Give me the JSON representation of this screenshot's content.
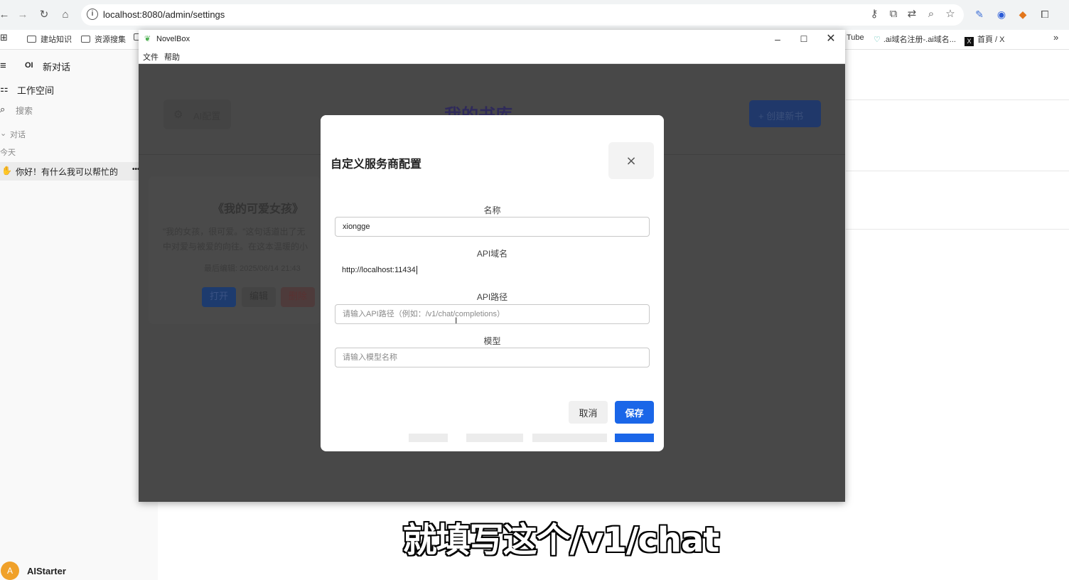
{
  "browser": {
    "url": "localhost:8080/admin/settings",
    "bookmarks": [
      "建站知识",
      "资源搜集",
      "Tube",
      ".ai域名注册-.ai域名...",
      "首頁 / X"
    ]
  },
  "sidebar": {
    "new_chat_logo": "OI",
    "new_chat": "新对话",
    "workspace": "工作空间",
    "search": "搜索",
    "section_chats": "对话",
    "today": "今天",
    "chat_item": "你好！有什么我可以帮忙的",
    "chat_more": "•••",
    "user_initial": "A",
    "user_name": "AIStarter"
  },
  "app": {
    "title": "NovelBox",
    "menu": [
      "文件",
      "帮助"
    ],
    "ai_config": "AI配置",
    "heading": "我的书库",
    "create_button": "+ 创建新书",
    "book_title": "《我的可爱女孩》",
    "book_excerpt_1": "\"我的女孩，很可爱。\"这句话道出了无",
    "book_excerpt_2": "中对爱与被爱的向往。在这本温暖的小",
    "last_edited": "最后编辑: 2025/06/14 21:43",
    "open": "打开",
    "edit": "编辑",
    "delete": "删除"
  },
  "modal": {
    "title": "自定义服务商配置",
    "close": "×",
    "name_label": "名称",
    "name_value": "xiongge",
    "domain_label": "API域名",
    "domain_value": "http://localhost:11434",
    "path_label": "API路径",
    "path_placeholder": "请输入API路径（例如：/v1/chat/completions）",
    "model_label": "模型",
    "model_placeholder": "请输入模型名称",
    "cancel": "取消",
    "save": "保存"
  },
  "subtitle": "就填写这个/v1/chat",
  "colors": {
    "primary": "#1a66e8",
    "overlay": "#484848",
    "avatar": "#f0a12a"
  }
}
